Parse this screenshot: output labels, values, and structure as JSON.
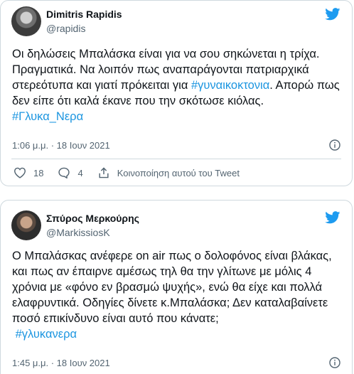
{
  "tweets": [
    {
      "author": "Dimitris Rapidis",
      "handle": "@rapidis",
      "text_parts": [
        "Οι δηλώσεις Μπαλάσκα είναι για να σου σηκώνεται η τρίχα. Πραγματικά. Να λοιπόν πως αναπαράγονται πατριαρχικά στερεότυπα και γιατί πρόκειται για ",
        "#γυναικοκτονια",
        ". Απορώ πως δεν είπε ότι καλά έκανε που την σκότωσε κιόλας.\n",
        "#Γλυκα_Νερα"
      ],
      "timestamp": "1:06 μ.μ. · 18 Ιουν 2021",
      "likes": "18",
      "replies": "4",
      "share_label": "Κοινοποίηση αυτού του Tweet"
    },
    {
      "author": "Σπύρος Μερκούρης",
      "handle": "@MarkissiosK",
      "text_parts": [
        "Ο Μπαλάσκας ανέφερε on air πως ο δολοφόνος είναι βλάκας, και πως αν έπαιρνε αμέσως τηλ θα την γλίτωνε με μόλις 4 χρόνια με «φόνο εν βρασμώ ψυχής», ενώ θα είχε και πολλά ελαφρυντικά. Οδηγίες δίνετε κ.Μπαλάσκα; Δεν καταλαβαίνετε ποσό επικίνδυνο είναι αυτό που κάνατε;\n ",
        "#γλυκανερα"
      ],
      "timestamp": "1:45 μ.μ. · 18 Ιουν 2021"
    }
  ],
  "colors": {
    "twitter_blue": "#1d9bf0",
    "hashtag": "#1b95e0",
    "secondary_text": "#536471",
    "border": "#cfd9de"
  }
}
